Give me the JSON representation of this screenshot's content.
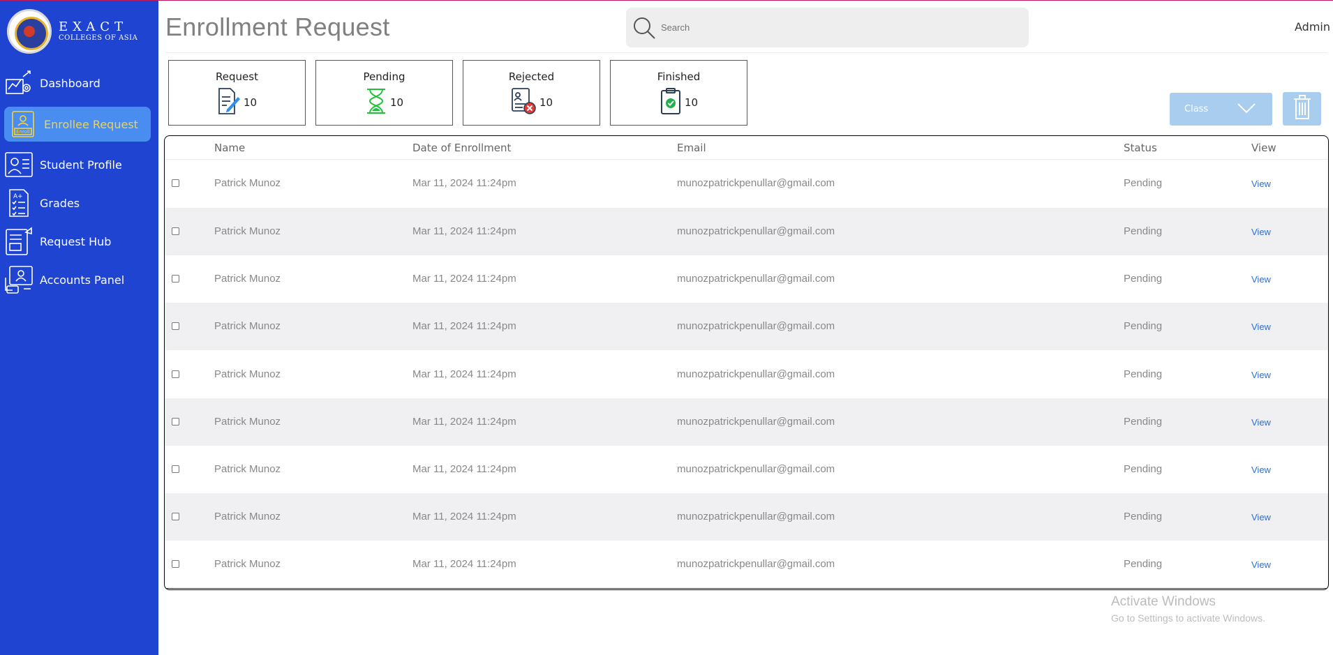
{
  "sidebar": {
    "logo": {
      "line1": "EXACT",
      "line2": "COLLEGES OF ASIA"
    },
    "items": [
      {
        "label": "Dashboard",
        "icon": "dashboard-chart-icon"
      },
      {
        "label": "Enrollee Request",
        "icon": "enroll-icon",
        "active": true
      },
      {
        "label": "Student Profile",
        "icon": "student-profile-icon"
      },
      {
        "label": "Grades",
        "icon": "grades-checklist-icon"
      },
      {
        "label": "Request Hub",
        "icon": "request-hub-icon"
      },
      {
        "label": "Accounts Panel",
        "icon": "accounts-panel-icon"
      }
    ]
  },
  "header": {
    "title": "Enrollment Request",
    "search_placeholder": "Search",
    "user": "Admin"
  },
  "cards": [
    {
      "title": "Request",
      "count": "10",
      "icon": "document-edit-icon"
    },
    {
      "title": "Pending",
      "count": "10",
      "icon": "hourglass-icon"
    },
    {
      "title": "Rejected",
      "count": "10",
      "icon": "rejected-document-icon"
    },
    {
      "title": "Finished",
      "count": "10",
      "icon": "clipboard-check-icon"
    }
  ],
  "toolbar": {
    "class_label": "Class"
  },
  "table": {
    "columns": [
      "Name",
      "Date of Enrollment",
      "Email",
      "Status",
      "View"
    ],
    "rows": [
      {
        "name": "Patrick Munoz",
        "date": "Mar 11, 2024 11:24pm",
        "email": "munozpatrickpenullar@gmail.com",
        "status": "Pending",
        "view": "View"
      },
      {
        "name": "Patrick Munoz",
        "date": "Mar 11, 2024 11:24pm",
        "email": "munozpatrickpenullar@gmail.com",
        "status": "Pending",
        "view": "View"
      },
      {
        "name": "Patrick Munoz",
        "date": "Mar 11, 2024 11:24pm",
        "email": "munozpatrickpenullar@gmail.com",
        "status": "Pending",
        "view": "View"
      },
      {
        "name": "Patrick Munoz",
        "date": "Mar 11, 2024 11:24pm",
        "email": "munozpatrickpenullar@gmail.com",
        "status": "Pending",
        "view": "View"
      },
      {
        "name": "Patrick Munoz",
        "date": "Mar 11, 2024 11:24pm",
        "email": "munozpatrickpenullar@gmail.com",
        "status": "Pending",
        "view": "View"
      },
      {
        "name": "Patrick Munoz",
        "date": "Mar 11, 2024 11:24pm",
        "email": "munozpatrickpenullar@gmail.com",
        "status": "Pending",
        "view": "View"
      },
      {
        "name": "Patrick Munoz",
        "date": "Mar 11, 2024 11:24pm",
        "email": "munozpatrickpenullar@gmail.com",
        "status": "Pending",
        "view": "View"
      },
      {
        "name": "Patrick Munoz",
        "date": "Mar 11, 2024 11:24pm",
        "email": "munozpatrickpenullar@gmail.com",
        "status": "Pending",
        "view": "View"
      },
      {
        "name": "Patrick Munoz",
        "date": "Mar 11, 2024 11:24pm",
        "email": "munozpatrickpenullar@gmail.com",
        "status": "Pending",
        "view": "View"
      }
    ]
  },
  "watermark": {
    "line1": "Activate Windows",
    "line2": "Go to Settings to activate Windows."
  },
  "colors": {
    "sidebar": "#1f44d1",
    "active_item": "#4a8df0",
    "active_text": "#f7d23c",
    "link": "#2b6fd6",
    "button": "#a8cdef"
  }
}
